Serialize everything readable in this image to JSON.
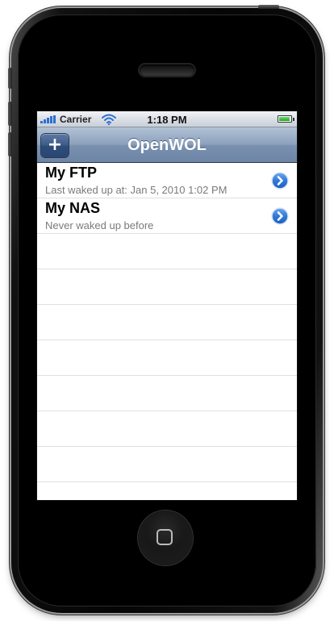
{
  "status_bar": {
    "carrier": "Carrier",
    "time": "1:18 PM",
    "battery_level": 0.9,
    "signal_bars": 5,
    "wifi_icon": "wifi-icon",
    "battery_icon": "battery-icon"
  },
  "nav_bar": {
    "title": "OpenWOL",
    "add_label": "+"
  },
  "hosts": [
    {
      "name": "My FTP",
      "subtitle": "Last waked up at: Jan 5, 2010 1:02 PM"
    },
    {
      "name": "My NAS",
      "subtitle": "Never waked up before"
    }
  ],
  "empty_rows": 7,
  "colors": {
    "nav_bar": "#7a91b0",
    "disclosure": "#2f7ad8",
    "subtitle": "#7a7a7a"
  }
}
